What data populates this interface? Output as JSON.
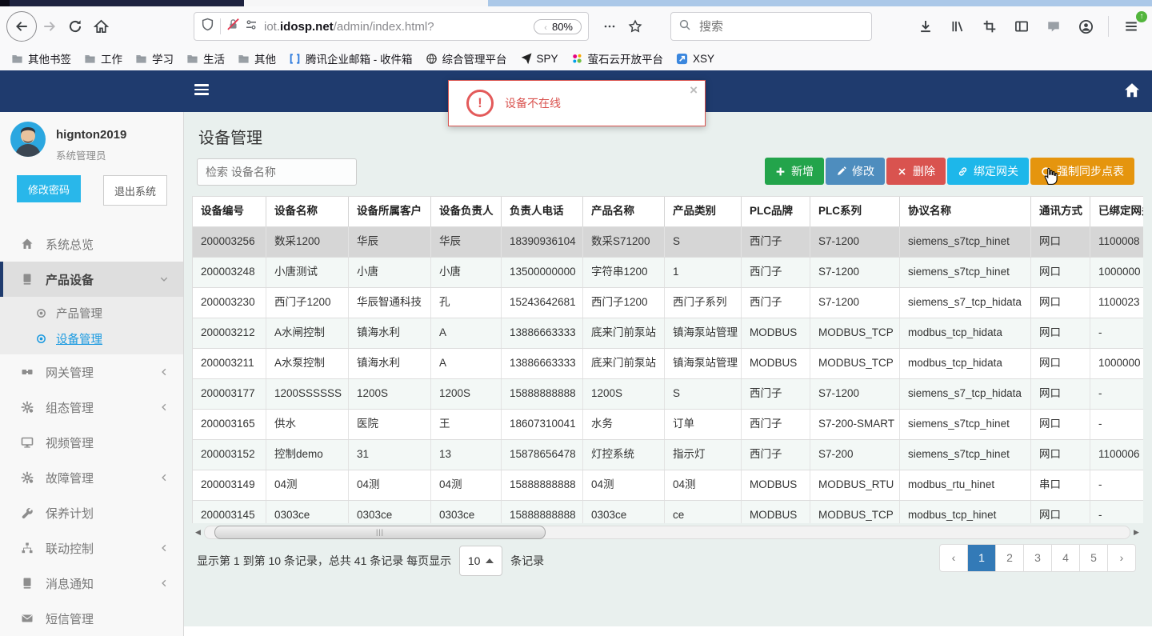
{
  "browser": {
    "url_prefix": "iot.",
    "url_domain": "idosp.net",
    "url_path": "/admin/index.html?",
    "zoom_badge": "80%",
    "search_placeholder": "搜索",
    "bookmarks": [
      {
        "label": "其他书签",
        "icon": "folder"
      },
      {
        "label": "工作",
        "icon": "folder"
      },
      {
        "label": "学习",
        "icon": "folder"
      },
      {
        "label": "生活",
        "icon": "folder"
      },
      {
        "label": "其他",
        "icon": "folder"
      },
      {
        "label": "腾讯企业邮箱 - 收件箱",
        "icon": "tencent"
      },
      {
        "label": "综合管理平台",
        "icon": "globe"
      },
      {
        "label": "SPY",
        "icon": "dart"
      },
      {
        "label": "萤石云开放平台",
        "icon": "dots4"
      },
      {
        "label": "XSY",
        "icon": "xsy"
      }
    ]
  },
  "app": {
    "alert": {
      "text": "设备不在线",
      "close": "×"
    },
    "user": {
      "name": "hignton2019",
      "role": "系统管理员",
      "btn_change_pwd": "修改密码",
      "btn_logout": "退出系统"
    },
    "menu": [
      {
        "id": "overview",
        "icon": "home",
        "label": "系统总览"
      },
      {
        "id": "product-device",
        "icon": "book",
        "label": "产品设备",
        "state": "expanded"
      },
      {
        "id": "product-mgmt",
        "icon": "dotcircle",
        "label": "产品管理",
        "sub": true
      },
      {
        "id": "device-mgmt",
        "icon": "dotcircle",
        "label": "设备管理",
        "sub": true,
        "selected": true
      },
      {
        "id": "gateway-mgmt",
        "icon": "gateway",
        "label": "网关管理",
        "chevron": true
      },
      {
        "id": "scada-mgmt",
        "icon": "gear",
        "label": "组态管理",
        "chevron": true
      },
      {
        "id": "video-mgmt",
        "icon": "monitor",
        "label": "视频管理"
      },
      {
        "id": "fault-mgmt",
        "icon": "gear",
        "label": "故障管理",
        "chevron": true
      },
      {
        "id": "maintenance-plan",
        "icon": "wrench",
        "label": "保养计划"
      },
      {
        "id": "linkage-control",
        "icon": "sitemap",
        "label": "联动控制",
        "chevron": true
      },
      {
        "id": "message-notify",
        "icon": "book",
        "label": "消息通知",
        "chevron": true
      },
      {
        "id": "sms-mgmt",
        "icon": "mail",
        "label": "短信管理"
      }
    ],
    "page_title": "设备管理",
    "device_search_placeholder": "检索 设备名称",
    "actions": [
      {
        "id": "add",
        "label": "新增",
        "icon": "plus",
        "color": "#23a44b"
      },
      {
        "id": "edit",
        "label": "修改",
        "icon": "pencil",
        "color": "#4e8dbe"
      },
      {
        "id": "delete",
        "label": "删除",
        "icon": "cross",
        "color": "#d9534f"
      },
      {
        "id": "bind-gateway",
        "label": "绑定网关",
        "icon": "link",
        "color": "#1db7ea"
      },
      {
        "id": "force-sync",
        "label": "强制同步点表",
        "icon": "refresh",
        "color": "#e5950e"
      }
    ],
    "table": {
      "columns": [
        "设备编号",
        "设备名称",
        "设备所属客户",
        "设备负责人",
        "负责人电话",
        "产品名称",
        "产品类别",
        "PLC品牌",
        "PLC系列",
        "协议名称",
        "通讯方式",
        "已绑定网关"
      ],
      "selected_row": 0,
      "rows": [
        [
          "200003256",
          "数采1200",
          "华辰",
          "华辰",
          "18390936104",
          "数采S71200",
          "S",
          "西门子",
          "S7-1200",
          "siemens_s7tcp_hinet",
          "网口",
          "1100008"
        ],
        [
          "200003248",
          "小唐测试",
          "小唐",
          "小唐",
          "13500000000",
          "字符串1200",
          "1",
          "西门子",
          "S7-1200",
          "siemens_s7tcp_hinet",
          "网口",
          "1000000"
        ],
        [
          "200003230",
          "西门子1200",
          "华辰智通科技",
          "孔",
          "15243642681",
          "西门子1200",
          "西门子系列",
          "西门子",
          "S7-1200",
          "siemens_s7_tcp_hidata",
          "网口",
          "1100023"
        ],
        [
          "200003212",
          "A水闸控制",
          "镇海水利",
          "A",
          "13886663333",
          "底来门前泵站",
          "镇海泵站管理",
          "MODBUS",
          "MODBUS_TCP",
          "modbus_tcp_hidata",
          "网口",
          "-"
        ],
        [
          "200003211",
          "A水泵控制",
          "镇海水利",
          "A",
          "13886663333",
          "底来门前泵站",
          "镇海泵站管理",
          "MODBUS",
          "MODBUS_TCP",
          "modbus_tcp_hidata",
          "网口",
          "1000000"
        ],
        [
          "200003177",
          "1200SSSSSS",
          "1200S",
          "1200S",
          "15888888888",
          "1200S",
          "S",
          "西门子",
          "S7-1200",
          "siemens_s7_tcp_hidata",
          "网口",
          "-"
        ],
        [
          "200003165",
          "供水",
          "医院",
          "王",
          "18607310041",
          "水务",
          "订单",
          "西门子",
          "S7-200-SMART",
          "siemens_s7tcp_hinet",
          "网口",
          "-"
        ],
        [
          "200003152",
          "控制demo",
          "31",
          "13",
          "15878656478",
          "灯控系统",
          "指示灯",
          "西门子",
          "S7-200",
          "siemens_s7tcp_hinet",
          "网口",
          "1100006"
        ],
        [
          "200003149",
          "04测",
          "04测",
          "04测",
          "15888888888",
          "04测",
          "04测",
          "MODBUS",
          "MODBUS_RTU",
          "modbus_rtu_hinet",
          "串口",
          "-"
        ],
        [
          "200003145",
          "0303ce",
          "0303ce",
          "0303ce",
          "15888888888",
          "0303ce",
          "ce",
          "MODBUS",
          "MODBUS_TCP",
          "modbus_tcp_hinet",
          "网口",
          "-"
        ]
      ]
    },
    "pagination": {
      "info_prefix": "显示第 1 到第 10 条记录，总共 41 条记录 每页显示",
      "per_page": "10",
      "info_suffix": "条记录",
      "pages": [
        "‹",
        "1",
        "2",
        "3",
        "4",
        "5",
        "›"
      ],
      "active": "1"
    },
    "colors": {
      "navbar": "#1f3b6e",
      "link_active": "#1b9ae0",
      "pagination_active": "#337ab7",
      "alert": "#d9534f"
    }
  }
}
